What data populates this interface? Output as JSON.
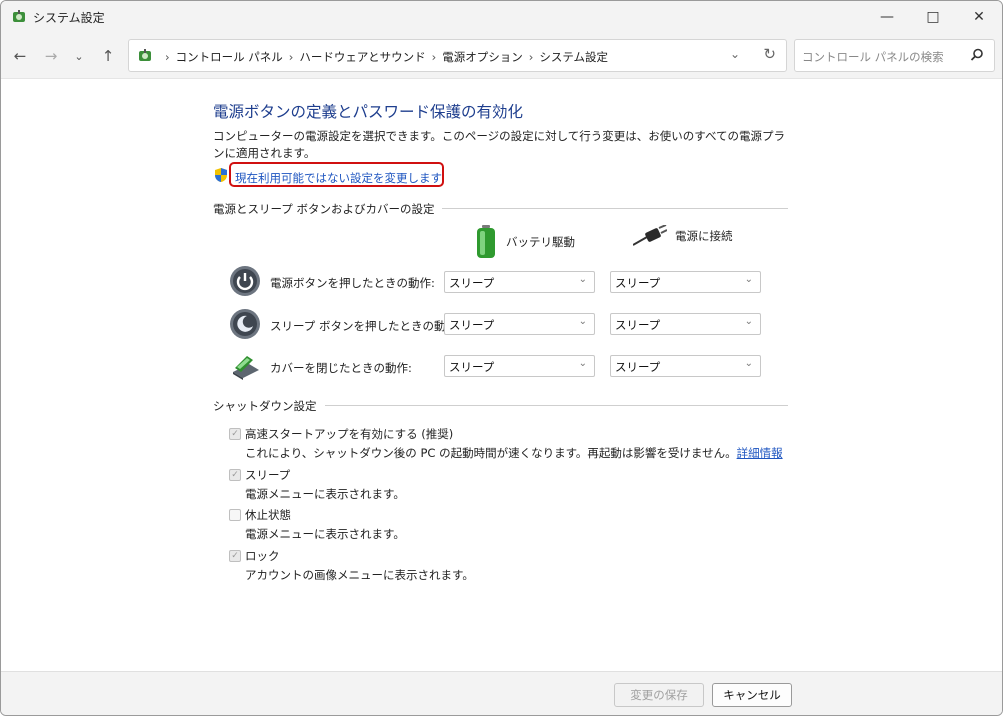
{
  "window": {
    "title": "システム設定"
  },
  "address": {
    "crumbs": [
      "コントロール パネル",
      "ハードウェアとサウンド",
      "電源オプション",
      "システム設定"
    ],
    "separator": "›"
  },
  "search": {
    "placeholder": "コントロール パネルの検索"
  },
  "page": {
    "heading": "電源ボタンの定義とパスワード保護の有効化",
    "description": "コンピューターの電源設定を選択できます。このページの設定に対して行う変更は、お使いのすべての電源プランに適用されます。",
    "change_link": "現在利用可能ではない設定を変更します"
  },
  "power_section": {
    "title": "電源とスリープ ボタンおよびカバーの設定",
    "col_battery": "バッテリ駆動",
    "col_plugged": "電源に接続",
    "rows": [
      {
        "label": "電源ボタンを押したときの動作:",
        "battery": "スリープ",
        "plugged": "スリープ"
      },
      {
        "label": "スリープ ボタンを押したときの動作:",
        "battery": "スリープ",
        "plugged": "スリープ"
      },
      {
        "label": "カバーを閉じたときの動作:",
        "battery": "スリープ",
        "plugged": "スリープ"
      }
    ]
  },
  "shutdown_section": {
    "title": "シャットダウン設定",
    "items": [
      {
        "label": "高速スタートアップを有効にする (推奨)",
        "checked": true,
        "desc": "これにより、シャットダウン後の PC の起動時間が速くなります。再起動は影響を受けません。",
        "link": "詳細情報"
      },
      {
        "label": "スリープ",
        "checked": true,
        "desc": "電源メニューに表示されます。"
      },
      {
        "label": "休止状態",
        "checked": false,
        "desc": "電源メニューに表示されます。"
      },
      {
        "label": "ロック",
        "checked": true,
        "desc": "アカウントの画像メニューに表示されます。"
      }
    ]
  },
  "footer": {
    "save": "変更の保存",
    "cancel": "キャンセル"
  },
  "colors": {
    "heading": "#1e3e8e",
    "link": "#1e55c0",
    "highlight": "#d01010"
  }
}
